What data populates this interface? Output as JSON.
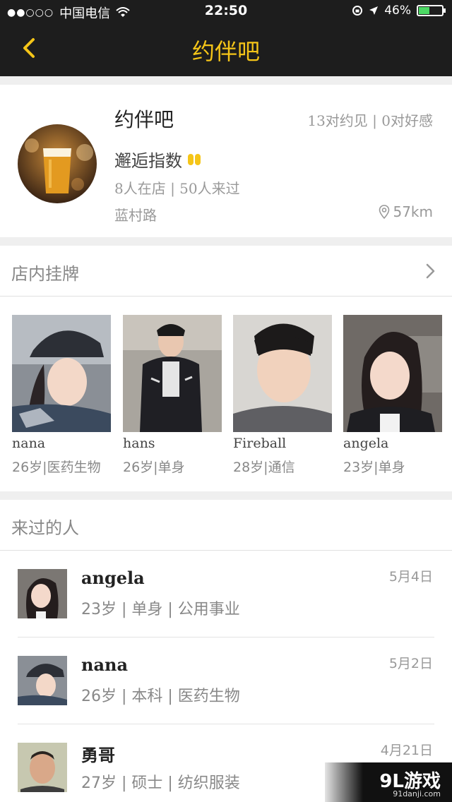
{
  "status_bar": {
    "carrier": "中国电信",
    "time": "22:50",
    "battery": "46%",
    "battery_level": 0.46
  },
  "nav": {
    "title": "约伴吧"
  },
  "venue": {
    "name": "约伴吧",
    "stats": "13对约见 | 0对好感",
    "index_label": "邂逅指数",
    "presence": "8人在店 | 50人来过",
    "street": "蓝村路",
    "distance": "57km"
  },
  "shop_section": {
    "title": "店内挂牌"
  },
  "gallery": [
    {
      "name": "nana",
      "info": "26岁|医药生物"
    },
    {
      "name": "hans",
      "info": "26岁|单身"
    },
    {
      "name": "Fireball",
      "info": "28岁|通信"
    },
    {
      "name": "angela",
      "info": "23岁|单身"
    }
  ],
  "visitors_section": {
    "title": "来过的人"
  },
  "visitors": [
    {
      "name": "angela",
      "info": "23岁 | 单身 | 公用事业",
      "date": "5月4日"
    },
    {
      "name": "nana",
      "info": "26岁 | 本科 | 医药生物",
      "date": "5月2日"
    },
    {
      "name": "勇哥",
      "info": "27岁 | 硕士 | 纺织服装",
      "date": "4月21日"
    }
  ],
  "watermark": {
    "brand": "9L游戏",
    "site": "91danji.com"
  },
  "colors": {
    "accent": "#f5c518",
    "nav_bg": "#1d1d1d",
    "battery": "#4cd964"
  }
}
